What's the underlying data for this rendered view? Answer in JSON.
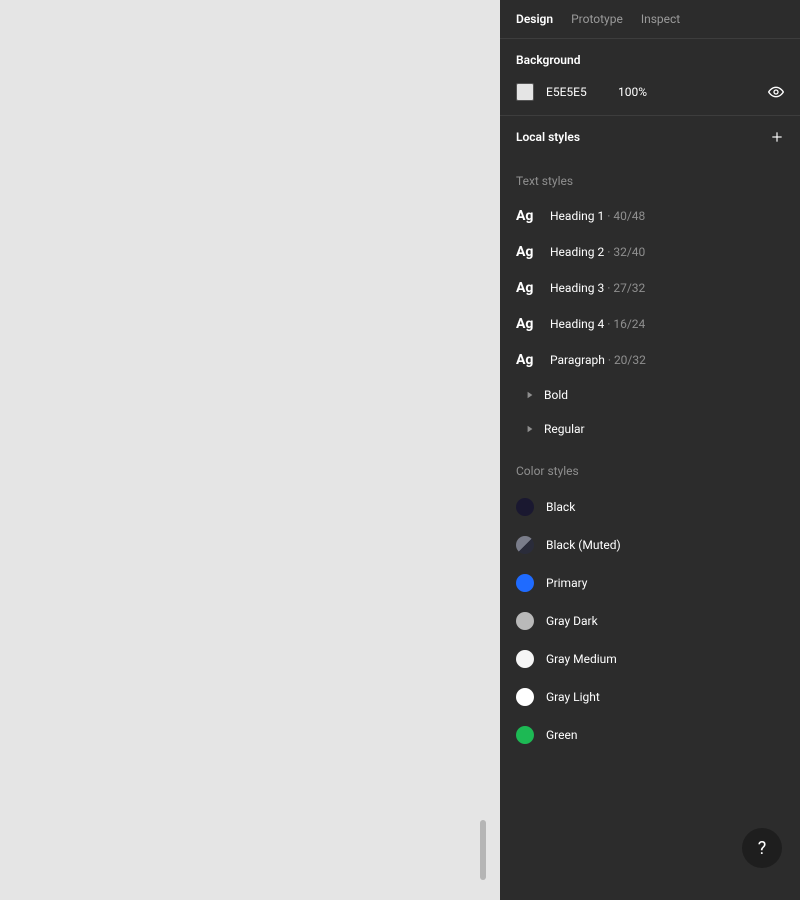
{
  "tabs": {
    "design": "Design",
    "prototype": "Prototype",
    "inspect": "Inspect"
  },
  "background": {
    "title": "Background",
    "hex": "E5E5E5",
    "opacity": "100%",
    "swatch_color": "#e5e5e5"
  },
  "local_styles": {
    "title": "Local styles",
    "text_styles_heading": "Text styles",
    "ag_label": "Ag",
    "text_styles": [
      {
        "name": "Heading 1",
        "meta": "· 40/48"
      },
      {
        "name": "Heading 2",
        "meta": "· 32/40"
      },
      {
        "name": "Heading 3",
        "meta": "· 27/32"
      },
      {
        "name": "Heading 4",
        "meta": "· 16/24"
      },
      {
        "name": "Paragraph",
        "meta": "· 20/32"
      }
    ],
    "paragraph_children": [
      {
        "label": "Bold"
      },
      {
        "label": "Regular"
      }
    ],
    "color_styles_heading": "Color styles",
    "color_styles": [
      {
        "label": "Black",
        "color": "#1a1830",
        "muted": false
      },
      {
        "label": "Black (Muted)",
        "color": "#2a2c3a",
        "muted": true
      },
      {
        "label": "Primary",
        "color": "#1f6bff",
        "muted": false
      },
      {
        "label": "Gray Dark",
        "color": "#b9b9b9",
        "muted": false
      },
      {
        "label": "Gray Medium",
        "color": "#f5f5f5",
        "muted": false
      },
      {
        "label": "Gray Light",
        "color": "#ffffff",
        "muted": false
      },
      {
        "label": "Green",
        "color": "#1db954",
        "muted": false
      }
    ]
  },
  "help": {
    "label": "?"
  }
}
